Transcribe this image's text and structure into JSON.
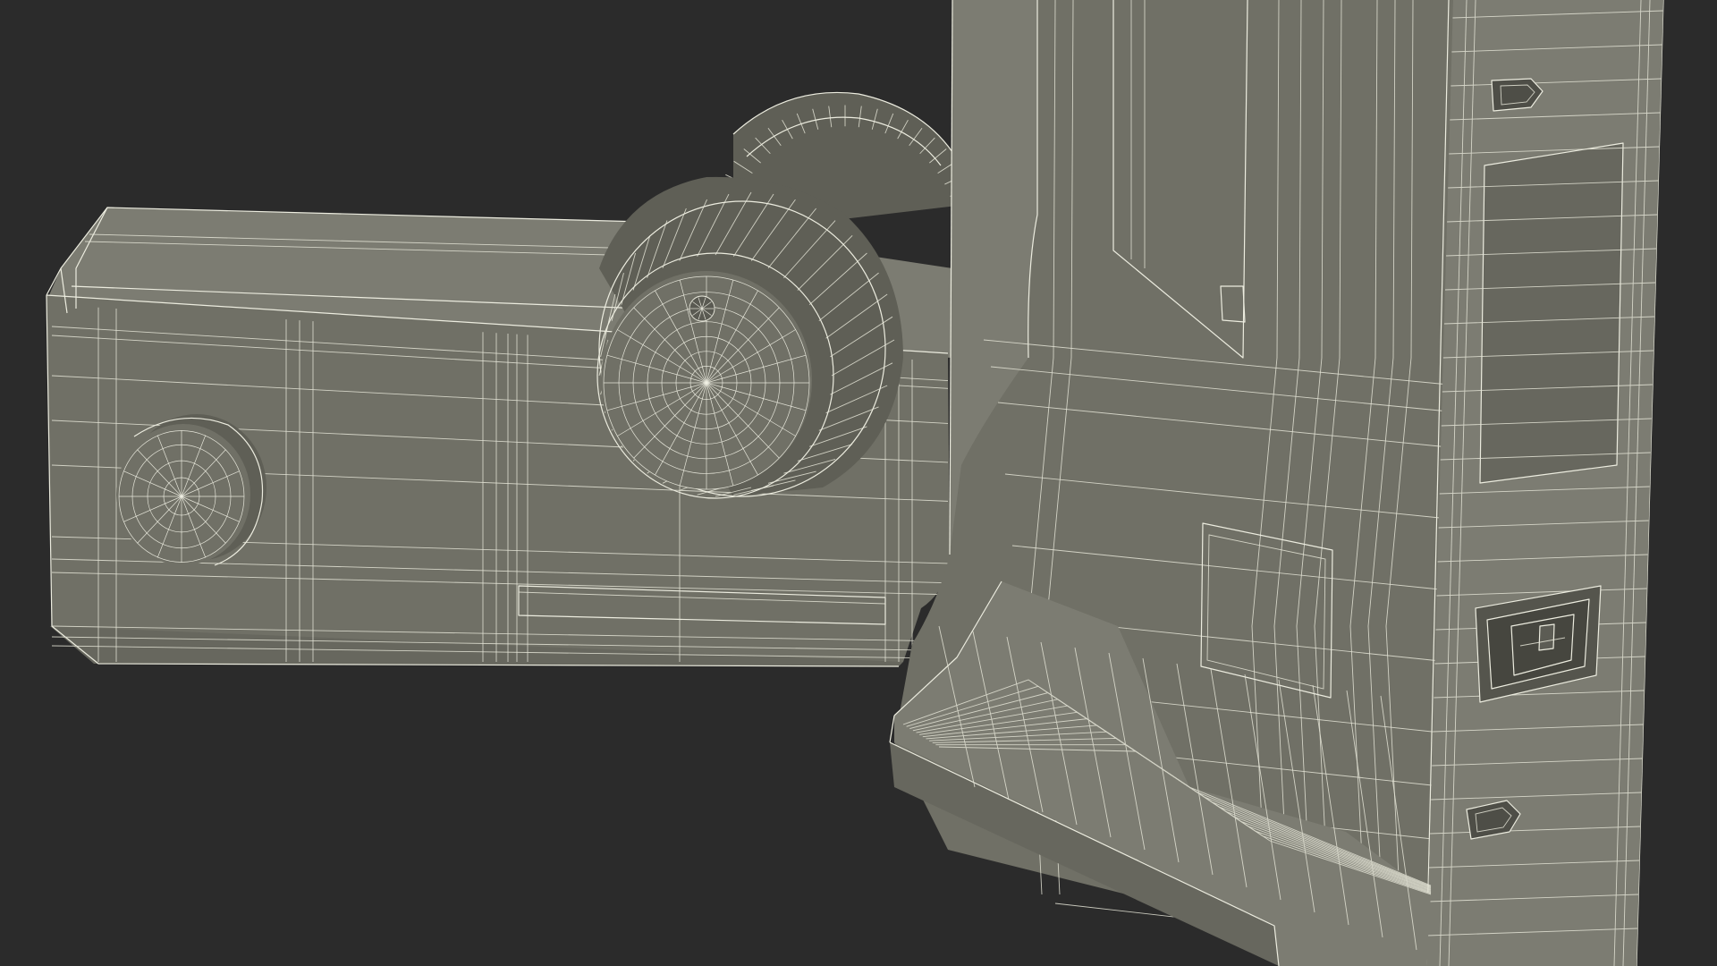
{
  "scene": {
    "background_color": "#2b2b2b",
    "model_color": "#707066",
    "wire_color": "#ececdf"
  },
  "parts": [
    {
      "name": "horizontal-arm"
    },
    {
      "name": "small-knob"
    },
    {
      "name": "large-knob"
    },
    {
      "name": "rear-gear"
    },
    {
      "name": "vertical-column"
    },
    {
      "name": "foot-base"
    },
    {
      "name": "power-inlet-socket"
    },
    {
      "name": "upper-slot"
    },
    {
      "name": "lower-slot"
    },
    {
      "name": "side-panel"
    }
  ]
}
